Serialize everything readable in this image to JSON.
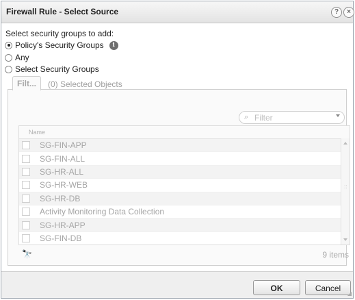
{
  "window": {
    "title": "Firewall Rule - Select Source",
    "help_label": "?",
    "close_label": "×"
  },
  "form": {
    "prompt": "Select security groups to add:",
    "options": [
      {
        "label": "Policy's Security Groups",
        "checked": true
      },
      {
        "label": "Any",
        "checked": false
      },
      {
        "label": "Select Security Groups",
        "checked": false
      }
    ],
    "info_glyph": "i"
  },
  "tabs": [
    {
      "label": "Filt...",
      "active": true
    },
    {
      "label": "(0) Selected Objects",
      "active": false
    }
  ],
  "filter": {
    "placeholder": "Filter",
    "search_glyph": "⌕"
  },
  "grid": {
    "column_header": "Name",
    "rows": [
      "SG-FIN-APP",
      "SG-FIN-ALL",
      "SG-HR-ALL",
      "SG-HR-WEB",
      "SG-HR-DB",
      "Activity Monitoring Data Collection",
      "SG-HR-APP",
      "SG-FIN-DB"
    ],
    "item_count": "9 items",
    "binoculars_glyph": "🔭"
  },
  "buttons": {
    "ok": "OK",
    "cancel": "Cancel"
  },
  "icons": {
    "help": "help-icon",
    "close": "close-icon",
    "info": "info-icon",
    "search": "search-icon",
    "find": "binoculars-icon"
  }
}
